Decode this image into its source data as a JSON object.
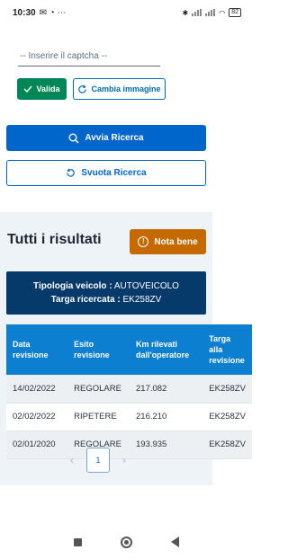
{
  "status_bar": {
    "time": "10:30",
    "battery": "82"
  },
  "captcha": {
    "placeholder": "-- Inserire il captcha --",
    "valida_label": "Valida",
    "cambia_label": "Cambia immagine"
  },
  "search": {
    "avvia_label": "Avvia Ricerca",
    "svuota_label": "Svuota Ricerca"
  },
  "results": {
    "title": "Tutti i risultati",
    "nota_bene_label": "Nota bene",
    "tipologia_label": "Tipologia veicolo :",
    "tipologia_value": "AUTOVEICOLO",
    "targa_label": "Targa ricercata :",
    "targa_value": "EK258ZV",
    "columns": [
      "Data revisione",
      "Esito revisione",
      "Km rilevati dall'operatore",
      "Targa alla revisione"
    ],
    "rows": [
      [
        "14/02/2022",
        "REGOLARE",
        "217.082",
        "EK258ZV"
      ],
      [
        "02/02/2022",
        "RIPETERE",
        "216.210",
        "EK258ZV"
      ],
      [
        "02/01/2020",
        "REGOLARE",
        "193.935",
        "EK258ZV"
      ]
    ]
  },
  "pagination": {
    "current_page": "1"
  },
  "icons": {
    "valida": "check-icon",
    "cambia": "refresh-icon",
    "avvia": "search-icon",
    "svuota": "rotate-icon",
    "nota_bene": "exclamation-icon"
  },
  "colors": {
    "primary": "#0066cc",
    "success": "#008758",
    "warning": "#c56a00",
    "dark_blue": "#063a6b",
    "table_header": "#0c7fd1"
  }
}
